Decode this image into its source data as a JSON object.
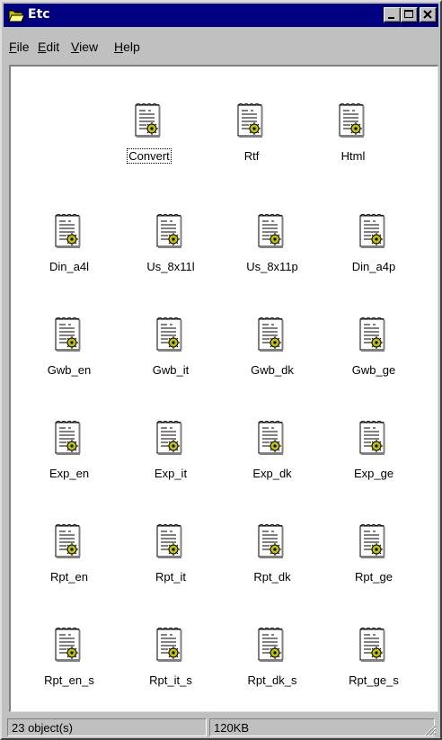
{
  "window": {
    "title": "Etc",
    "icon": "folder-open-icon"
  },
  "title_buttons": [
    "minimize",
    "maximize",
    "close"
  ],
  "menu": [
    "File",
    "Edit",
    "View",
    "Help"
  ],
  "files": [
    {
      "name": "Convert",
      "selected": true
    },
    {
      "name": "Rtf"
    },
    {
      "name": "Html"
    },
    {
      "name": "Din_a4l"
    },
    {
      "name": "Us_8x11l"
    },
    {
      "name": "Us_8x11p"
    },
    {
      "name": "Din_a4p"
    },
    {
      "name": "Gwb_en"
    },
    {
      "name": "Gwb_it"
    },
    {
      "name": "Gwb_dk"
    },
    {
      "name": "Gwb_ge"
    },
    {
      "name": "Exp_en"
    },
    {
      "name": "Exp_it"
    },
    {
      "name": "Exp_dk"
    },
    {
      "name": "Exp_ge"
    },
    {
      "name": "Rpt_en"
    },
    {
      "name": "Rpt_it"
    },
    {
      "name": "Rpt_dk"
    },
    {
      "name": "Rpt_ge"
    },
    {
      "name": "Rpt_en_s"
    },
    {
      "name": "Rpt_it_s"
    },
    {
      "name": "Rpt_dk_s"
    },
    {
      "name": "Rpt_ge_s"
    }
  ],
  "file_icon": "document-gear-icon",
  "status": {
    "objects": "23 object(s)",
    "size": "120KB"
  },
  "colors": {
    "titlebar": "#000080",
    "face": "#c0c0c0",
    "client": "#ffffff",
    "gear": "#c0c000"
  }
}
